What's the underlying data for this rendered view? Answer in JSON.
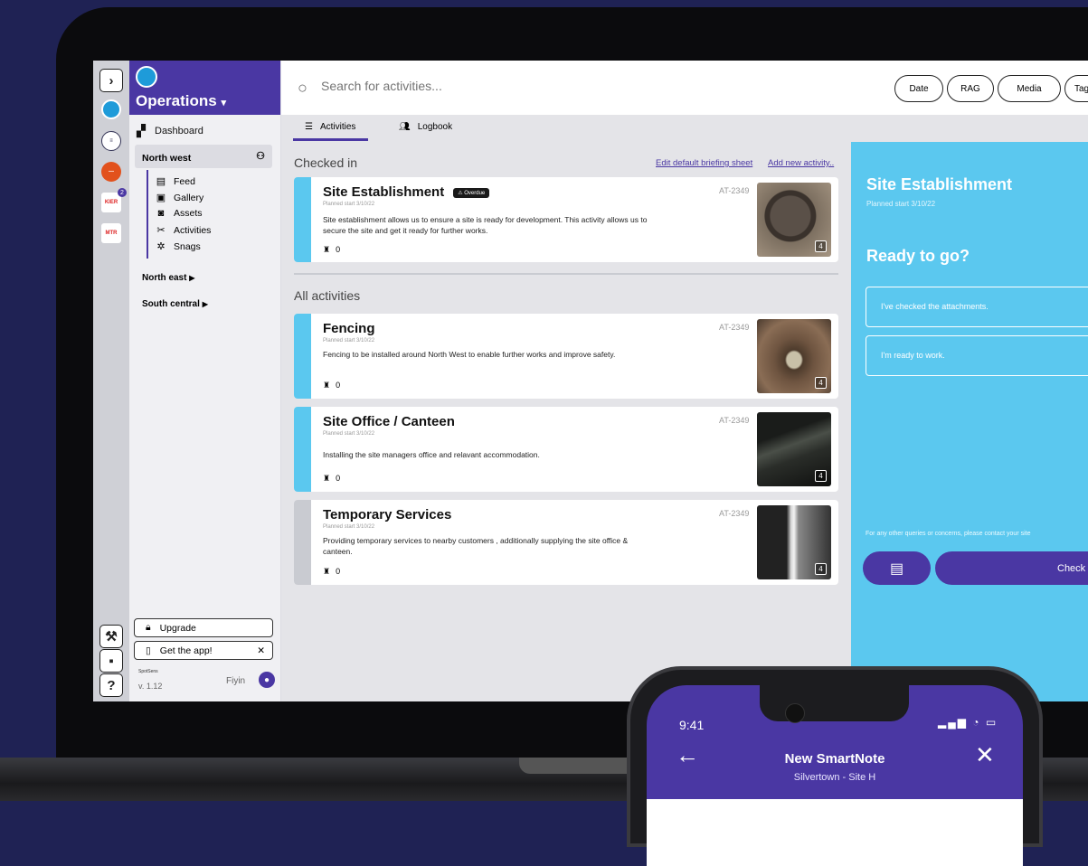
{
  "colors": {
    "accent": "#4a37a3",
    "panel": "#5bc8ef",
    "background": "#1f2254"
  },
  "sidebar": {
    "title": "Operations",
    "title_caret": "▾",
    "dashboard": "Dashboard",
    "region_active": "North west",
    "sub_items": [
      {
        "label": "Feed",
        "icon": "feed-icon"
      },
      {
        "label": "Gallery",
        "icon": "gallery-icon"
      },
      {
        "label": "Assets",
        "icon": "assets-icon"
      },
      {
        "label": "Activities",
        "icon": "activities-icon"
      },
      {
        "label": "Snags",
        "icon": "snags-icon"
      }
    ],
    "region_2": "North east",
    "region_3": "South central",
    "upgrade": "Upgrade",
    "get_app": "Get the app!",
    "version": "v. 1.12",
    "brand_small": "SpotSens",
    "user": "Fiyin",
    "org_badge": "2"
  },
  "search": {
    "placeholder": "Search for activities..."
  },
  "filters": [
    "Date",
    "RAG",
    "Media",
    "Tag"
  ],
  "tabs": [
    {
      "label": "Activities"
    },
    {
      "label": "Logbook"
    }
  ],
  "checked_in": {
    "heading": "Checked in",
    "link_edit": "Edit default briefing sheet",
    "link_add": "Add new activity..",
    "card": {
      "title": "Site Establishment",
      "badge": "Overdue",
      "planned": "Planned start 3/10/22",
      "desc": "Site establishment allows us to ensure a site is ready for development. This activity allows us to secure the site and get it ready for further works.",
      "count": "0",
      "code": "AT-2349",
      "photos": "4"
    }
  },
  "all_activities": {
    "heading": "All activities",
    "cards": [
      {
        "title": "Fencing",
        "planned": "Planned start 3/10/22",
        "desc": "Fencing to be installed around North West to enable further works and improve safety.",
        "count": "0",
        "code": "AT-2349",
        "photos": "4"
      },
      {
        "title": "Site Office / Canteen",
        "planned": "Planned start 3/10/22",
        "desc": "Installing the site managers office and relavant accommodation.",
        "count": "0",
        "code": "AT-2349",
        "photos": "4"
      },
      {
        "title": "Temporary Services",
        "planned": "Planned start 3/10/22",
        "desc": "Providing temporary services to nearby customers , additionally supplying the site office & canteen.",
        "count": "0",
        "code": "AT-2349",
        "photos": "4"
      }
    ]
  },
  "panel": {
    "title": "Site Establishment",
    "planned": "Planned start 3/10/22",
    "ready": "Ready to go?",
    "check_1": "I've checked the attachments.",
    "check_2": "I'm ready to work.",
    "note": "For any other queries or concerns, please contact your site",
    "check_in": "Check i"
  },
  "phone": {
    "time": "9:41",
    "title": "New SmartNote",
    "subtitle": "Silvertown - Site H"
  }
}
